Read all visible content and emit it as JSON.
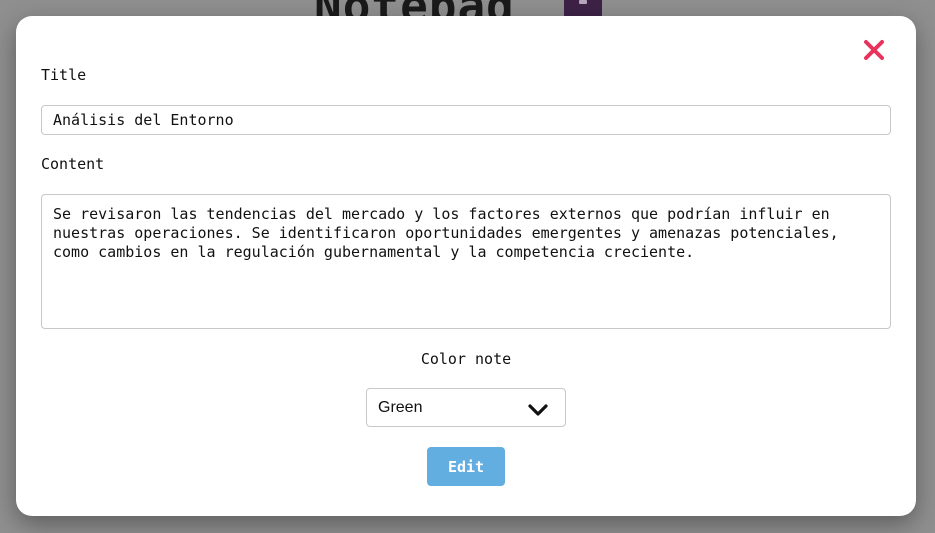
{
  "background": {
    "app_title": "Notepad",
    "notepad_icon": "notepad-icon"
  },
  "modal": {
    "close_icon": "close-icon",
    "close_color": "#e8335c",
    "title_label": "Title",
    "title_value": "Análisis del Entorno",
    "content_label": "Content",
    "content_value": "Se revisaron las tendencias del mercado y los factores externos que podrían influir en nuestras operaciones. Se identificaron oportunidades emergentes y amenazas potenciales, como cambios en la regulación gubernamental y la competencia creciente.",
    "color_label": "Color note",
    "color_selected": "Green",
    "color_select_icon": "chevron-down-icon",
    "submit_label": "Edit",
    "submit_color": "#62aee0"
  }
}
